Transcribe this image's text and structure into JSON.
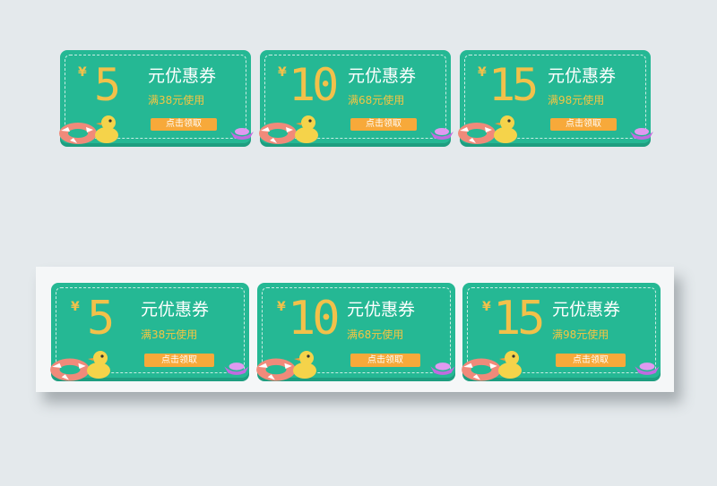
{
  "colors": {
    "background": "#e4e9ec",
    "coupon_fill": "#25b894",
    "coupon_edge": "#1e9e80",
    "amount": "#f2c14a",
    "condition": "#f5c542",
    "button": "#f7a93a",
    "panel": "#f5f7f8"
  },
  "top_row": {
    "coupons": [
      {
        "currency": "¥",
        "amount": "5",
        "title": "元优惠券",
        "condition": "满38元使用",
        "button": "点击领取"
      },
      {
        "currency": "¥",
        "amount": "10",
        "title": "元优惠券",
        "condition": "满68元使用",
        "button": "点击领取"
      },
      {
        "currency": "¥",
        "amount": "15",
        "title": "元优惠券",
        "condition": "满98元使用",
        "button": "点击领取"
      }
    ]
  },
  "bottom_row": {
    "coupons": [
      {
        "currency": "¥",
        "amount": "5",
        "title": "元优惠券",
        "condition": "满38元使用",
        "button": "点击领取"
      },
      {
        "currency": "¥",
        "amount": "10",
        "title": "元优惠券",
        "condition": "满68元使用",
        "button": "点击领取"
      },
      {
        "currency": "¥",
        "amount": "15",
        "title": "元优惠券",
        "condition": "满98元使用",
        "button": "点击领取"
      }
    ]
  },
  "decorations": [
    "swim-ring-icon",
    "rubber-duck-icon",
    "gold-ingot-icon"
  ]
}
